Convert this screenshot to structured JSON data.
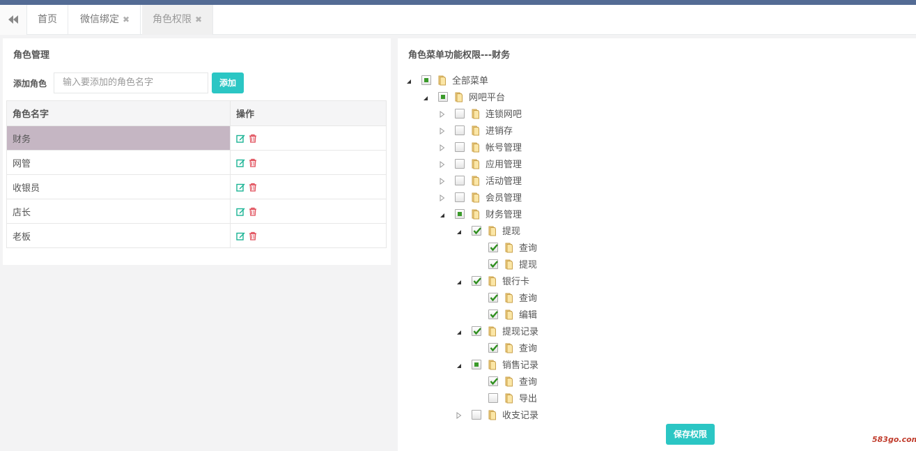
{
  "tabs": [
    {
      "label": "首页",
      "closable": false,
      "active": false
    },
    {
      "label": "微信绑定",
      "closable": true,
      "active": false
    },
    {
      "label": "角色权限",
      "closable": true,
      "active": true
    }
  ],
  "left": {
    "title": "角色管理",
    "add_label": "添加角色",
    "add_placeholder": "输入要添加的角色名字",
    "add_button": "添加",
    "table": {
      "headers": [
        "角色名字",
        "操作"
      ],
      "rows": [
        "财务",
        "网管",
        "收银员",
        "店长",
        "老板"
      ],
      "selected_index": 0
    }
  },
  "right": {
    "title": "角色菜单功能权限---财务",
    "save_button": "保存权限",
    "tree": [
      {
        "label": "全部菜单",
        "level": 0,
        "expander": "open",
        "check": "partial"
      },
      {
        "label": "网吧平台",
        "level": 1,
        "expander": "open",
        "check": "partial"
      },
      {
        "label": "连锁网吧",
        "level": 2,
        "expander": "closed",
        "check": "none"
      },
      {
        "label": "进销存",
        "level": 2,
        "expander": "closed",
        "check": "none"
      },
      {
        "label": "帐号管理",
        "level": 2,
        "expander": "closed",
        "check": "none"
      },
      {
        "label": "应用管理",
        "level": 2,
        "expander": "closed",
        "check": "none"
      },
      {
        "label": "活动管理",
        "level": 2,
        "expander": "closed",
        "check": "none"
      },
      {
        "label": "会员管理",
        "level": 2,
        "expander": "closed",
        "check": "none"
      },
      {
        "label": "财务管理",
        "level": 2,
        "expander": "open",
        "check": "partial"
      },
      {
        "label": "提现",
        "level": 3,
        "expander": "open",
        "check": "checked"
      },
      {
        "label": "查询",
        "level": 4,
        "expander": "none",
        "check": "checked"
      },
      {
        "label": "提现",
        "level": 4,
        "expander": "none",
        "check": "checked"
      },
      {
        "label": "银行卡",
        "level": 3,
        "expander": "open",
        "check": "checked"
      },
      {
        "label": "查询",
        "level": 4,
        "expander": "none",
        "check": "checked"
      },
      {
        "label": "编辑",
        "level": 4,
        "expander": "none",
        "check": "checked"
      },
      {
        "label": "提现记录",
        "level": 3,
        "expander": "open",
        "check": "checked"
      },
      {
        "label": "查询",
        "level": 4,
        "expander": "none",
        "check": "checked"
      },
      {
        "label": "销售记录",
        "level": 3,
        "expander": "open",
        "check": "partial"
      },
      {
        "label": "查询",
        "level": 4,
        "expander": "none",
        "check": "checked"
      },
      {
        "label": "导出",
        "level": 4,
        "expander": "none",
        "check": "none"
      },
      {
        "label": "收支记录",
        "level": 3,
        "expander": "closed",
        "check": "none"
      }
    ]
  },
  "watermark": "583go.com",
  "colors": {
    "accent": "#2bc6c4",
    "topbar": "#536b94",
    "selected_row": "#c5b6c3",
    "check_green": "#3a9a2a"
  }
}
